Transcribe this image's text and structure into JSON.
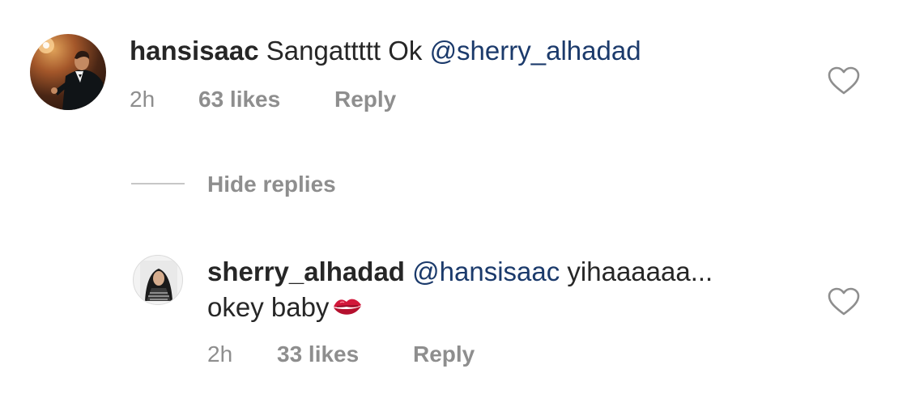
{
  "comment": {
    "username": "hansisaac",
    "text": "Sangattttt Ok ",
    "mention": "@sherry_alhadad",
    "time": "2h",
    "likes": "63 likes",
    "reply_label": "Reply"
  },
  "replies_toggle": {
    "label": "Hide replies"
  },
  "reply": {
    "username": "sherry_alhadad",
    "mention": "@hansisaac",
    "text_line1": " yihaaaaaa...",
    "text_line2": "okey baby",
    "emoji": "kiss-mark-icon",
    "time": "2h",
    "likes": "33 likes",
    "reply_label": "Reply"
  },
  "colors": {
    "text": "#262626",
    "secondary": "#8e8e8e",
    "mention": "#1b3a6b",
    "divider": "#c7c7c7"
  }
}
